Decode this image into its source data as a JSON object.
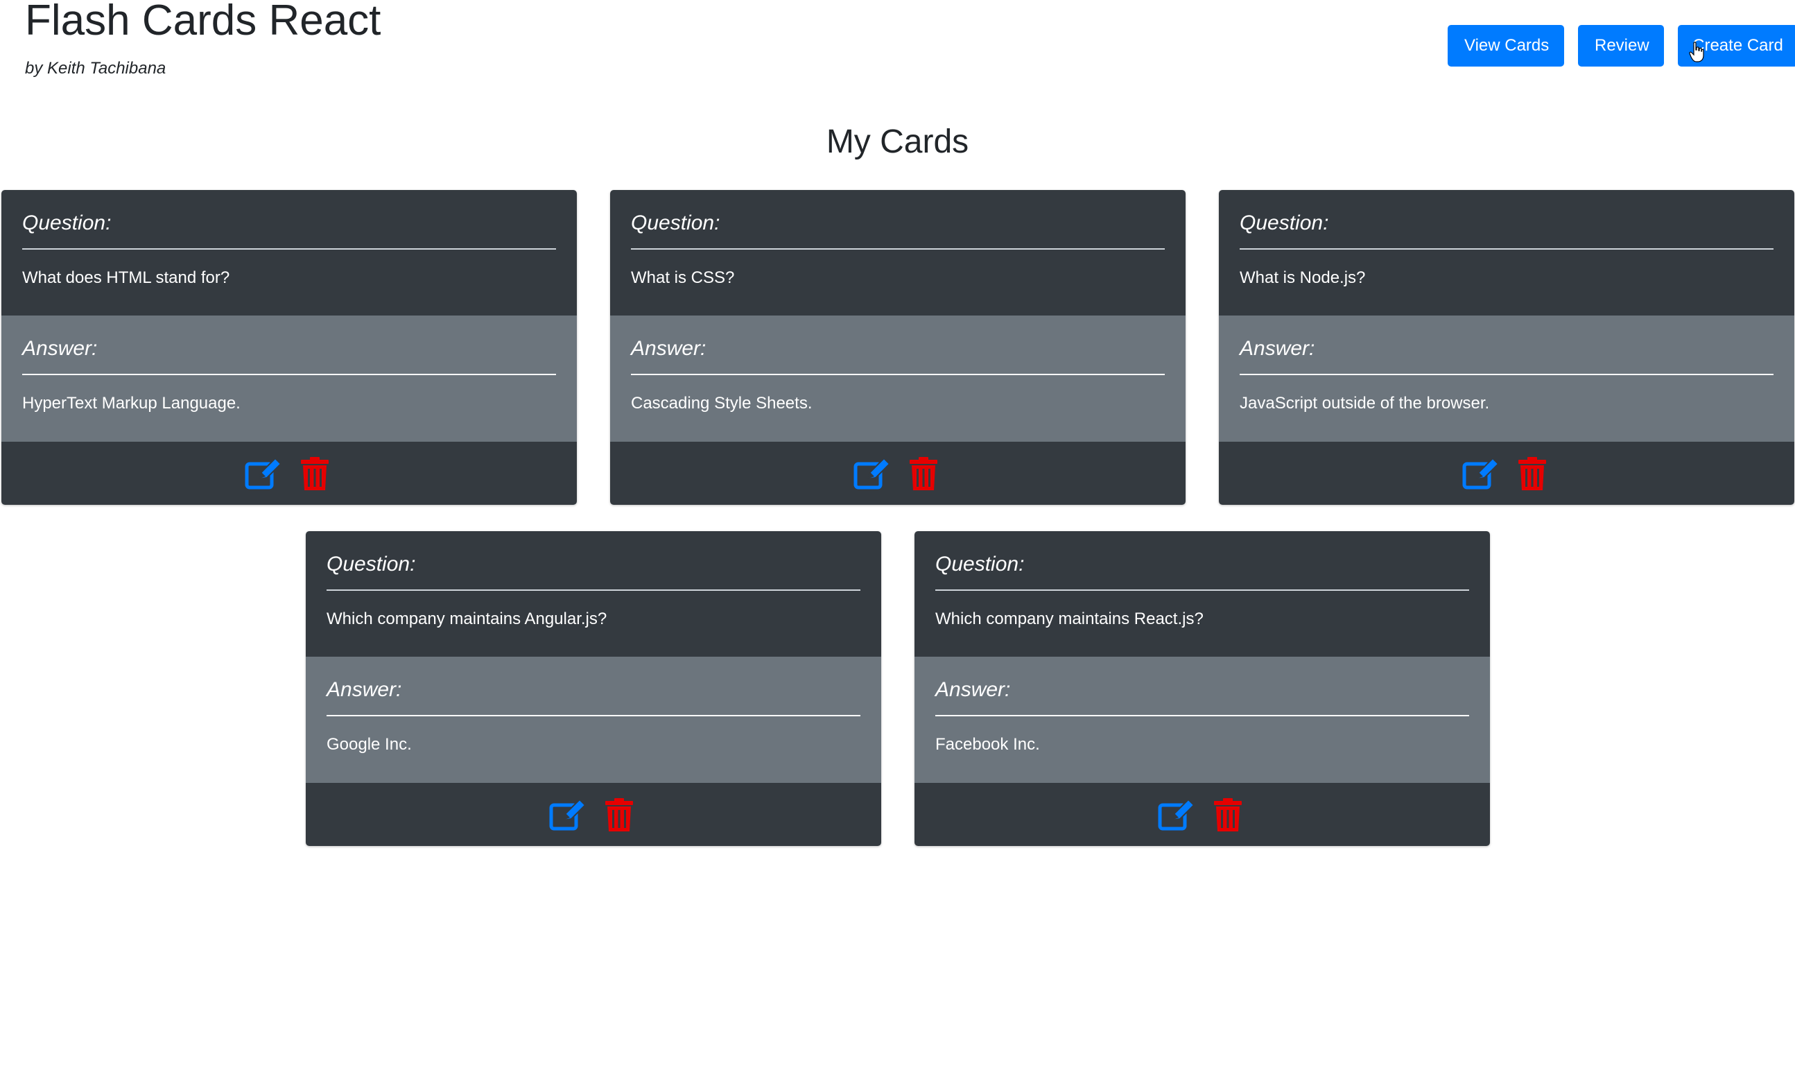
{
  "header": {
    "title": "Flash Cards React",
    "author": "by Keith Tachibana"
  },
  "nav": {
    "view_cards": "View Cards",
    "review": "Review",
    "create_card": "Create Card"
  },
  "page": {
    "heading": "My Cards"
  },
  "card_labels": {
    "question": "Question:",
    "answer": "Answer:"
  },
  "cards": [
    {
      "question": "What does HTML stand for?",
      "answer": "HyperText Markup Language."
    },
    {
      "question": "What is CSS?",
      "answer": "Cascading Style Sheets."
    },
    {
      "question": "What is Node.js?",
      "answer": "JavaScript outside of the browser."
    },
    {
      "question": "Which company maintains Angular.js?",
      "answer": "Google Inc."
    },
    {
      "question": "Which company maintains React.js?",
      "answer": "Facebook Inc."
    }
  ],
  "icons": {
    "edit": "edit-icon",
    "delete": "trash-icon"
  },
  "colors": {
    "primary": "#007bff",
    "card_dark": "#343a40",
    "card_gray": "#6c757d",
    "delete_red": "#e60000"
  }
}
